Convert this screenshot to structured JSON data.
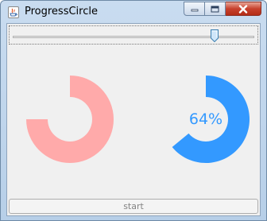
{
  "window": {
    "title": "ProgressCircle"
  },
  "slider": {
    "value_percent": 84
  },
  "gauges": [
    {
      "value_percent": 75,
      "label": "",
      "color": "#ffaaaa"
    },
    {
      "value_percent": 64,
      "label": "64%",
      "color": "#3399ff"
    }
  ],
  "start_button": {
    "label": "start"
  },
  "colors": {
    "gauge_left": "#ffaaaa",
    "gauge_right": "#3399ff",
    "label_text": "#3399ff"
  },
  "icons": [
    "java-app-icon",
    "minimize-icon",
    "maximize-icon",
    "close-icon",
    "slider-thumb"
  ]
}
